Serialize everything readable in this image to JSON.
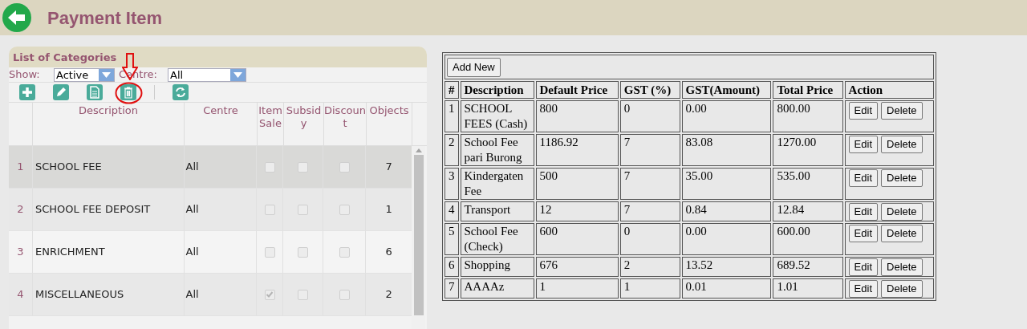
{
  "header": {
    "title": "Payment Item"
  },
  "categories": {
    "title": "List of Categories",
    "show_label": "Show:",
    "show_value": "Active",
    "centre_label": "Centre:",
    "centre_value": "All",
    "columns": [
      "Description",
      "Centre",
      "Item Sale",
      "Subsidy",
      "Discount",
      "Objects"
    ],
    "rows": [
      {
        "index": "1",
        "description": "SCHOOL FEE",
        "centre": "All",
        "item_sale": false,
        "subsidy": false,
        "discount": false,
        "objects": "7",
        "selected": true
      },
      {
        "index": "2",
        "description": "SCHOOL FEE DEPOSIT",
        "centre": "All",
        "item_sale": false,
        "subsidy": false,
        "discount": false,
        "objects": "1",
        "selected": false
      },
      {
        "index": "3",
        "description": "ENRICHMENT",
        "centre": "All",
        "item_sale": false,
        "subsidy": false,
        "discount": false,
        "objects": "6",
        "selected": false
      },
      {
        "index": "4",
        "description": "MISCELLANEOUS",
        "centre": "All",
        "item_sale": true,
        "subsidy": false,
        "discount": false,
        "objects": "2",
        "selected": false
      }
    ]
  },
  "items": {
    "add_button": "Add New",
    "columns": [
      "#",
      "Description",
      "Default Price",
      "GST (%)",
      "GST(Amount)",
      "Total Price",
      "Action"
    ],
    "rows": [
      {
        "index": "1",
        "description": "SCHOOL FEES (Cash)",
        "default_price": "800",
        "gst_percent": "0",
        "gst_amount": "0.00",
        "total_price": "800.00",
        "edit_label": "Edit",
        "delete_label": "Delete"
      },
      {
        "index": "2",
        "description": "School Fee pari Burong",
        "default_price": "1186.92",
        "gst_percent": "7",
        "gst_amount": "83.08",
        "total_price": "1270.00",
        "edit_label": "Edit",
        "delete_label": "Delete"
      },
      {
        "index": "3",
        "description": "Kindergaten Fee",
        "default_price": "500",
        "gst_percent": "7",
        "gst_amount": "35.00",
        "total_price": "535.00",
        "edit_label": "Edit",
        "delete_label": "Delete"
      },
      {
        "index": "4",
        "description": "Transport",
        "default_price": "12",
        "gst_percent": "7",
        "gst_amount": "0.84",
        "total_price": "12.84",
        "edit_label": "Edit",
        "delete_label": "Delete"
      },
      {
        "index": "5",
        "description": "School Fee (Check)",
        "default_price": "600",
        "gst_percent": "0",
        "gst_amount": "0.00",
        "total_price": "600.00",
        "edit_label": "Edit",
        "delete_label": "Delete"
      },
      {
        "index": "6",
        "description": "Shopping",
        "default_price": "676",
        "gst_percent": "2",
        "gst_amount": "13.52",
        "total_price": "689.52",
        "edit_label": "Edit",
        "delete_label": "Delete"
      },
      {
        "index": "7",
        "description": "AAAAz",
        "default_price": "1",
        "gst_percent": "1",
        "gst_amount": "0.01",
        "total_price": "1.01",
        "edit_label": "Edit",
        "delete_label": "Delete"
      }
    ]
  }
}
